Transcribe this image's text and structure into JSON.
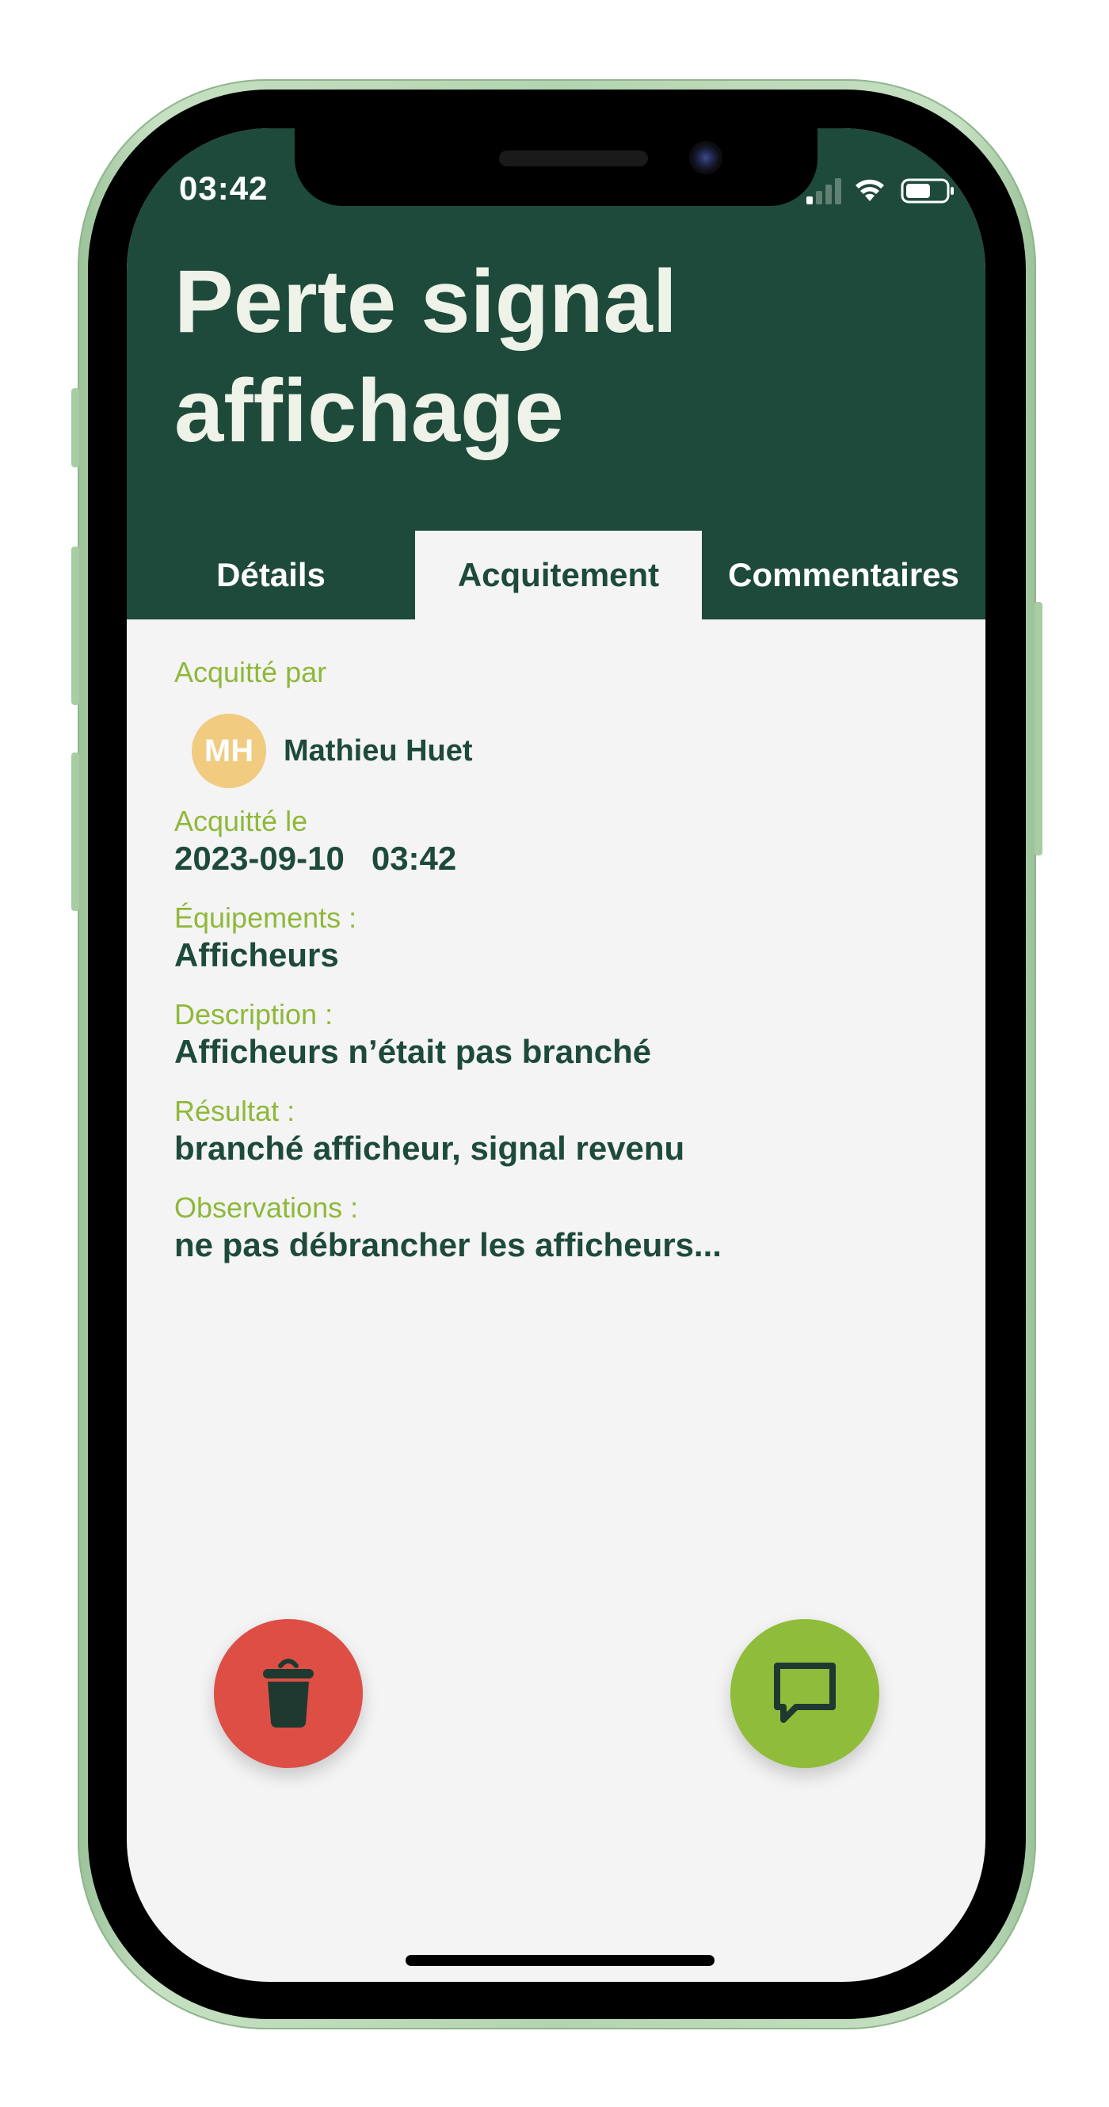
{
  "status_bar": {
    "time": "03:42"
  },
  "header": {
    "title": "Perte signal affichage"
  },
  "tabs": [
    {
      "label": "Détails",
      "active": false
    },
    {
      "label": "Acquitement",
      "active": true
    },
    {
      "label": "Commentaires",
      "active": false
    }
  ],
  "acknowledgement": {
    "by_label": "Acquitté par",
    "user_initials": "MH",
    "user_name": "Mathieu Huet",
    "date_label": "Acquitté le",
    "date": "2023-09-10",
    "time": "03:42",
    "equipment_label": "Équipements :",
    "equipment": "Afficheurs",
    "description_label": "Description :",
    "description": "Afficheurs n’était pas branché",
    "result_label": "Résultat :",
    "result": "branché afficheur, signal revenu",
    "observations_label": "Observations :",
    "observations": "ne pas débrancher les afficheurs..."
  },
  "actions": {
    "delete_icon": "trash-icon",
    "comment_icon": "comment-icon"
  },
  "colors": {
    "header_bg": "#1e4a3b",
    "accent_green": "#8fbc3a",
    "label_green": "#8fb83a",
    "delete_red": "#dd4e45",
    "avatar_bg": "#f0cb80",
    "device_frame": "#b4d4b0"
  }
}
